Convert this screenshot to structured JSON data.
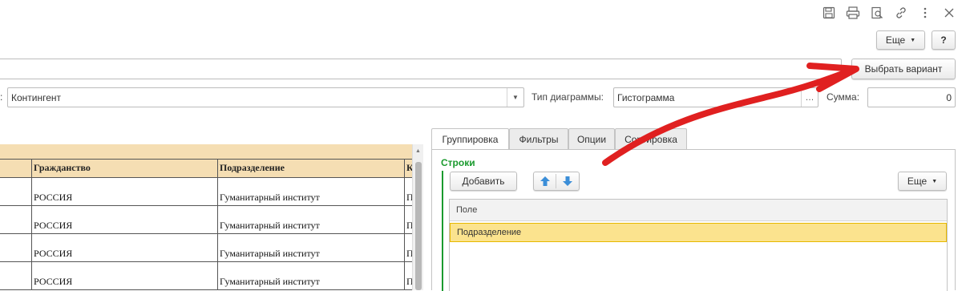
{
  "toolbar": {
    "icons": [
      "save-icon",
      "print-icon",
      "preview-icon",
      "link-icon",
      "more-vertical-icon",
      "close-icon"
    ],
    "more_label": "Еще",
    "help_label": "?"
  },
  "variant": {
    "button_label": "Выбрать вариант"
  },
  "settings": {
    "contingent_value": "Контингент",
    "chart_type_label": "Тип диаграммы:",
    "chart_type_value": "Гистограмма",
    "sum_label": "Сумма:",
    "sum_value": "0",
    "colon_label": ":"
  },
  "table": {
    "columns": [
      "Гражданство",
      "Подразделение",
      "К"
    ],
    "rows": [
      [
        "РОССИЯ",
        "Гуманитарный институт",
        "П"
      ],
      [
        "РОССИЯ",
        "Гуманитарный институт",
        "П"
      ],
      [
        "РОССИЯ",
        "Гуманитарный институт",
        "П"
      ],
      [
        "РОССИЯ",
        "Гуманитарный институт",
        "П"
      ]
    ]
  },
  "tabs": [
    "Группировка",
    "Фильтры",
    "Опции",
    "Сортировка"
  ],
  "grouping": {
    "section_title": "Строки",
    "add_label": "Добавить",
    "more_label": "Еще",
    "grid_header": "Поле",
    "rows": [
      "Подразделение"
    ]
  },
  "colors": {
    "table_header_bg": "#f5deb3",
    "selected_row_bg": "#fbe38e",
    "section_title": "#1a9a2e",
    "arrow_blue": "#3b8ed8",
    "annotation_arrow": "#e02020"
  }
}
